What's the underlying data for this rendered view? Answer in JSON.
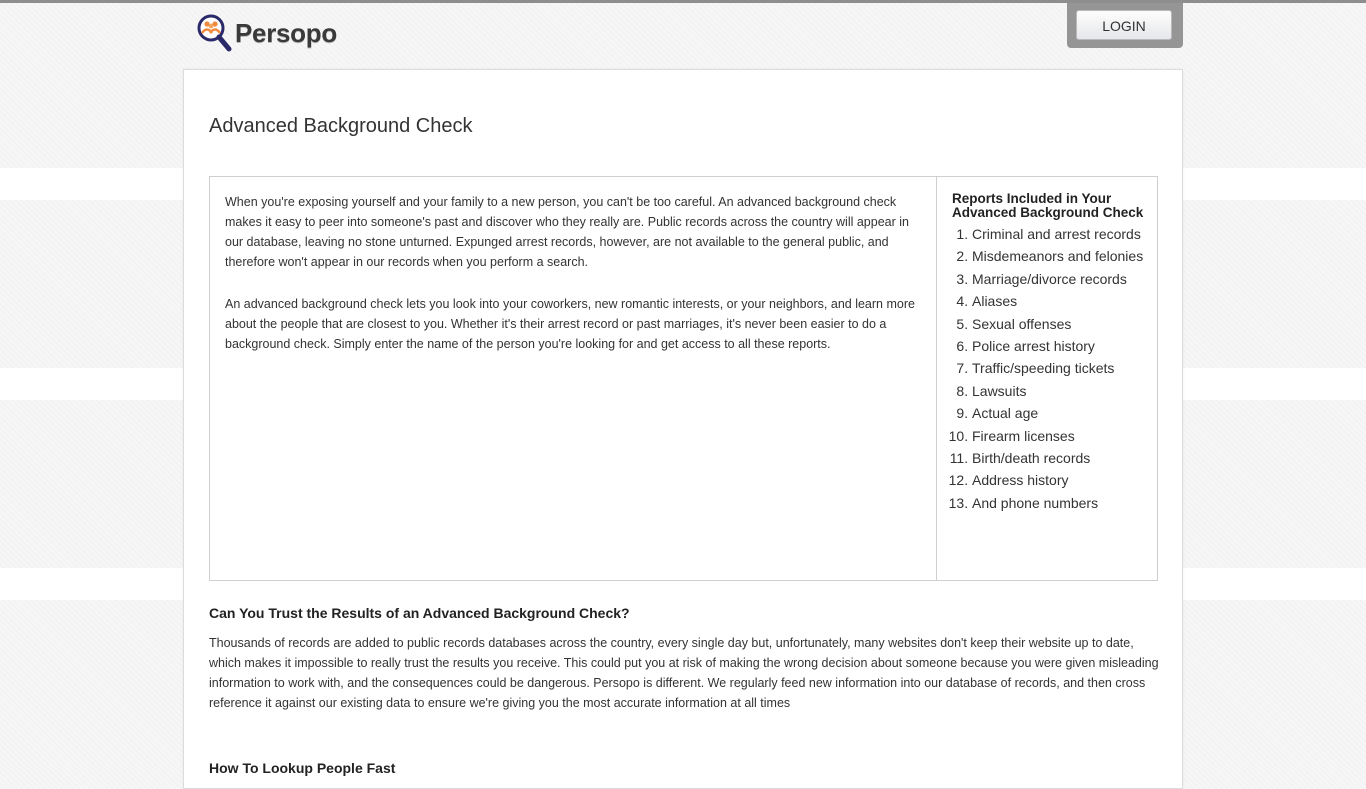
{
  "header": {
    "brand": "Persopo",
    "logo_icon": "magnifier-people-icon",
    "login_label": "LOGIN"
  },
  "colors": {
    "logo_people": "#f08a3c",
    "logo_glass": "#2a2a6a",
    "login_frame": "#959595"
  },
  "main": {
    "title": "Advanced Background Check",
    "intro_paragraphs": [
      "When you're exposing yourself and your family to a new person, you can't be too careful. An advanced background check makes it easy to peer into someone's past and discover who they really are. Public records across the country will appear in our database, leaving no stone unturned. Expunged arrest records, however, are not available to the general public, and therefore won't appear in our records when you perform a search.",
      "An advanced background check lets you look into your coworkers, new romantic interests, or your neighbors, and learn more about the people that are closest to you. Whether it's their arrest record or past marriages, it's never been easier to do a background check. Simply enter the name of the person you're looking for and get access to all these reports."
    ],
    "reports": {
      "title": "Reports Included in Your Advanced Background Check",
      "items": [
        "Criminal and arrest records",
        "Misdemeanors and felonies",
        "Marriage/divorce records",
        "Aliases",
        "Sexual offenses",
        "Police arrest history",
        "Traffic/speeding tickets",
        "Lawsuits",
        "Actual age",
        "Firearm licenses",
        "Birth/death records",
        "Address history",
        "And phone numbers"
      ]
    },
    "trust_section": {
      "heading": "Can You Trust the Results of an Advanced Background Check?",
      "body": "Thousands of records are added to public records databases across the country, every single day but, unfortunately, many websites don't keep their website up to date, which makes it impossible to really trust the results you receive. This could put you at risk of making the wrong decision about someone because you were given misleading information to work with, and the consequences could be dangerous. Persopo is different. We regularly feed new information into our database of records, and then cross reference it against our existing data to ensure we're giving you the most accurate information at all times"
    },
    "lookup_section": {
      "heading": "How To Lookup People Fast"
    }
  }
}
